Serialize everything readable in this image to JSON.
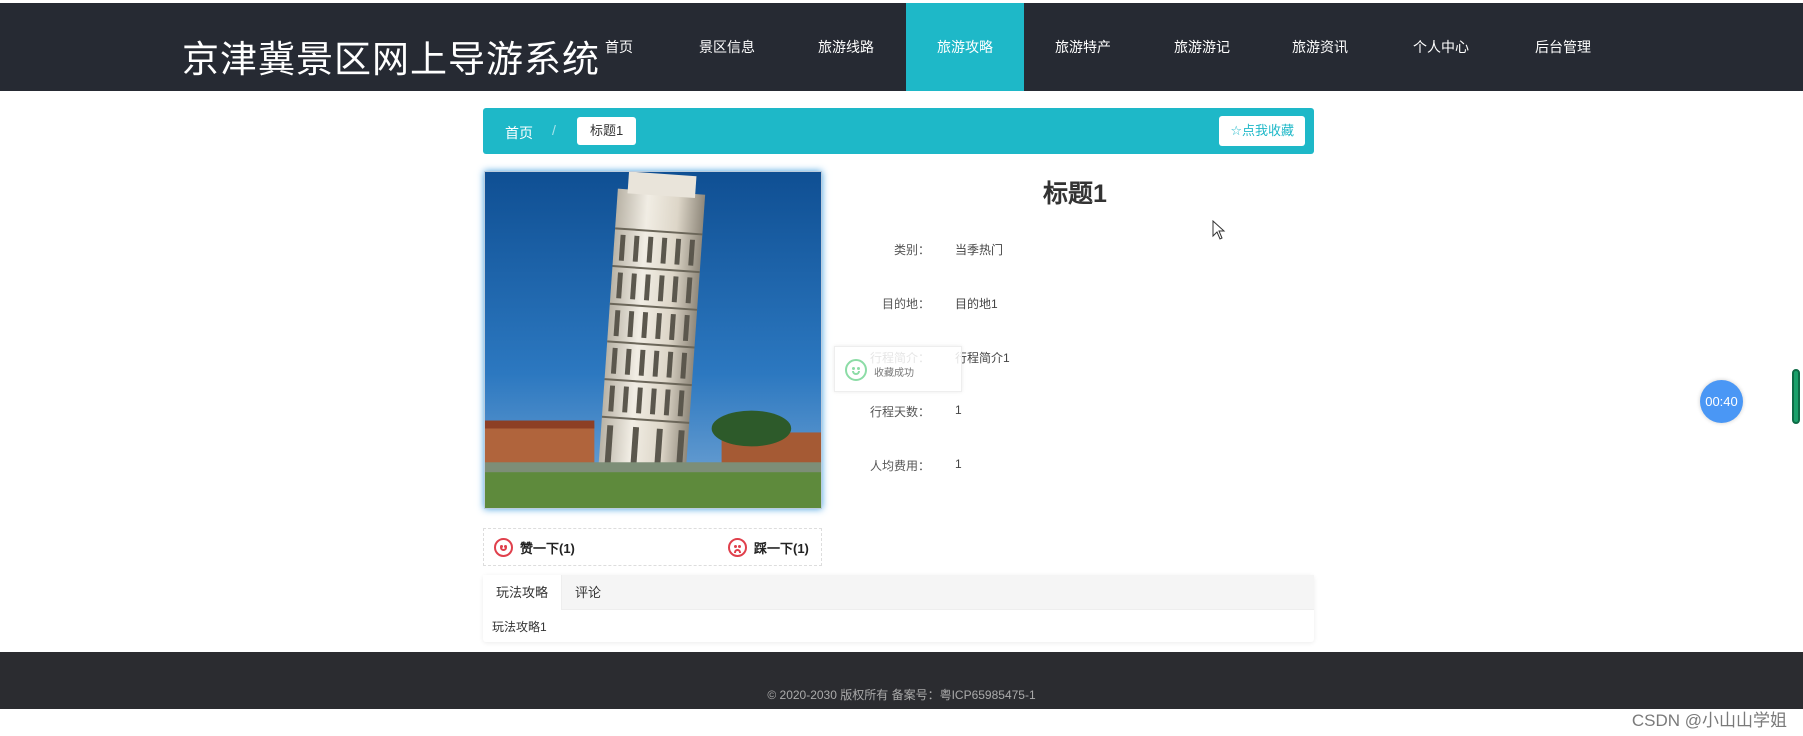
{
  "header": {
    "site_title": "京津冀景区网上导游系统",
    "nav": [
      {
        "label": "首页"
      },
      {
        "label": "景区信息"
      },
      {
        "label": "旅游线路"
      },
      {
        "label": "旅游攻略",
        "active": true
      },
      {
        "label": "旅游特产"
      },
      {
        "label": "旅游游记"
      },
      {
        "label": "旅游资讯"
      },
      {
        "label": "个人中心"
      },
      {
        "label": "后台管理"
      }
    ]
  },
  "breadcrumb": {
    "home": "首页",
    "separator": "/",
    "current": "标题1",
    "favorite_label": "☆点我收藏"
  },
  "detail": {
    "title": "标题1",
    "fields": [
      {
        "label": "类别：",
        "value": "当季热门"
      },
      {
        "label": "目的地：",
        "value": "目的地1"
      },
      {
        "label": "行程简介：",
        "value": "行程简介1"
      },
      {
        "label": "行程天数：",
        "value": "1"
      },
      {
        "label": "人均费用：",
        "value": "1"
      }
    ]
  },
  "votes": {
    "like_label": "赞一下(1)",
    "dislike_label": "踩一下(1)"
  },
  "toast": {
    "message": "收藏成功"
  },
  "tabs": {
    "items": [
      {
        "label": "玩法攻略",
        "active": true
      },
      {
        "label": "评论"
      }
    ],
    "content": "玩法攻略1"
  },
  "timer": {
    "value": "00:40"
  },
  "footer": {
    "copyright": "© 2020-2030 版权所有 备案号：粤ICP65985475-1"
  },
  "watermark": "CSDN @小山山学姐",
  "colors": {
    "accent": "#1eb8c8",
    "header_bg": "#262a33",
    "footer_bg": "#2b2c30",
    "vote_icon": "#e0404c",
    "timer_bg": "#4a97f5"
  },
  "icons": [
    "star-icon",
    "smile-icon",
    "frown-icon",
    "toast-smile-icon",
    "cursor-icon"
  ]
}
